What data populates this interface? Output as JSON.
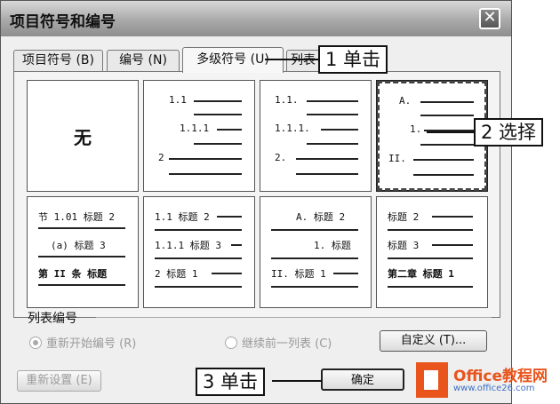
{
  "dialog": {
    "title": "项目符号和编号",
    "close_glyph": "✕",
    "tabs": [
      "项目符号 (B)",
      "编号 (N)",
      "多级符号 (U)",
      "列表"
    ],
    "none_label": "无",
    "grid": {
      "c2": {
        "l1": "1.1",
        "l2": "1.1.1",
        "l3": "2"
      },
      "c3": {
        "l1": "1.1.",
        "l2": "1.1.1.",
        "l3": "2."
      },
      "c4": {
        "l1": "A.",
        "l2": "1.",
        "l3": "II."
      },
      "c5": {
        "l1": "节 1.01 标题 2",
        "l2": "(a) 标题 3",
        "l3": "第 II 条 标题"
      },
      "c6": {
        "l1": "1.1 标题 2",
        "l2": "1.1.1 标题 3",
        "l3": "2 标题 1"
      },
      "c7": {
        "l1": "A. 标题 2",
        "l2": "1. 标题",
        "l3": "II. 标题 1"
      },
      "c8": {
        "l1": "标题 2",
        "l2": "标题 3",
        "l3": "第二章 标题 1"
      }
    },
    "list_numbering_label": "列表编号",
    "restart_label": "重新开始编号 (R)",
    "continue_label": "继续前一列表 (C)",
    "customize_label": "自定义 (T)...",
    "reset_label": "重新设置 (E)",
    "ok_label": "确定"
  },
  "annotations": {
    "a1": "1 单击",
    "a2": "2 选择",
    "a3": "3 单击"
  },
  "watermark": {
    "name": "Office教程网",
    "url": "www.office26.com"
  },
  "colors": {
    "logo": "#e8541c",
    "logo_sub": "#3a6fc2"
  }
}
